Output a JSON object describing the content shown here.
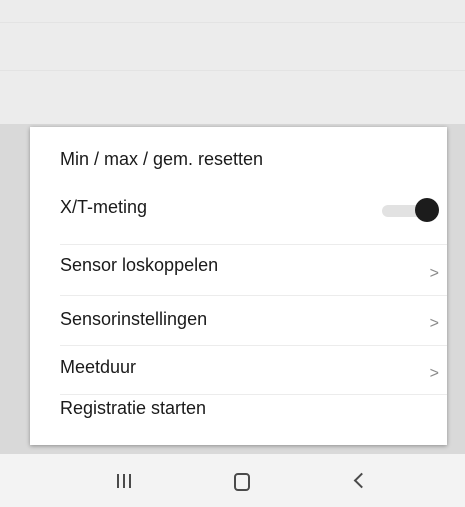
{
  "menu": {
    "items": [
      {
        "label": "Min / max / gem. resetten"
      },
      {
        "label": "X/T-meting",
        "toggle_on": true
      },
      {
        "label": "Sensor loskoppelen",
        "chevron": ">"
      },
      {
        "label": "Sensorinstellingen",
        "chevron": ">"
      },
      {
        "label": "Meetduur",
        "chevron": ">"
      },
      {
        "label": "Registratie starten"
      }
    ]
  },
  "navbar": {
    "buttons": [
      {
        "icon": "recents-icon"
      },
      {
        "icon": "home-icon"
      },
      {
        "icon": "back-icon"
      }
    ]
  },
  "colors": {
    "toggle_knob": "#1c1c1c",
    "toggle_track": "#e2e2e2",
    "chevron": "#8a8a8a"
  }
}
